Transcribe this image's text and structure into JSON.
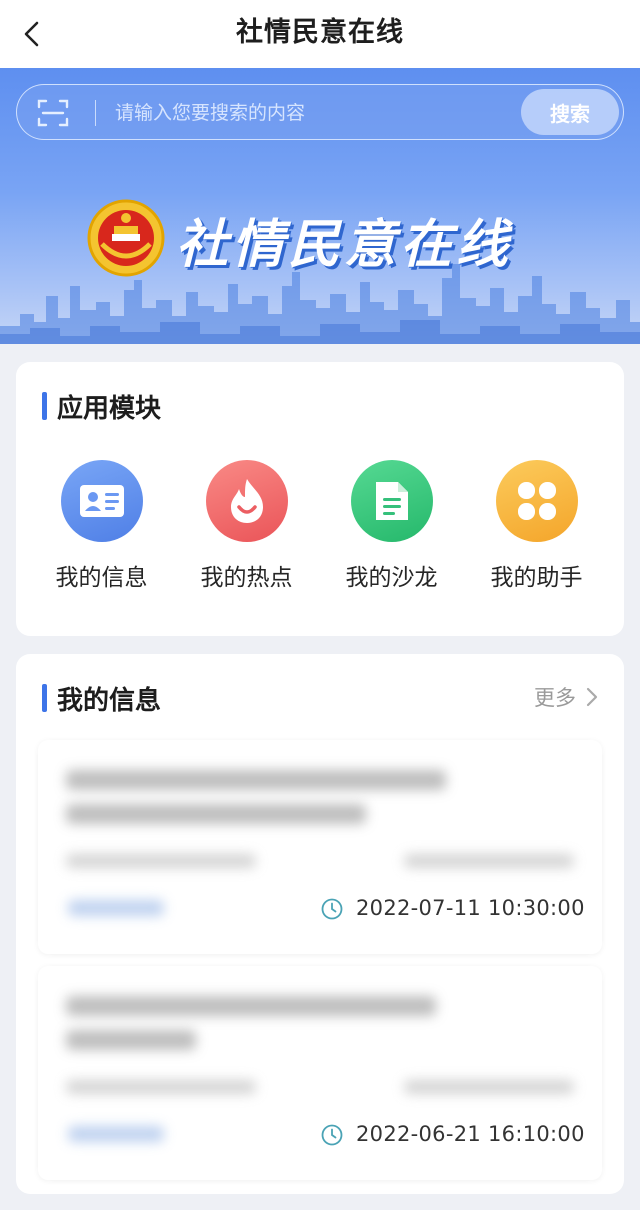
{
  "header": {
    "title": "社情民意在线",
    "back_icon": "chevron-left-icon"
  },
  "search": {
    "placeholder": "请输入您要搜索的内容",
    "button_label": "搜索",
    "scan_icon": "scan-icon"
  },
  "hero": {
    "title": "社情民意在线",
    "emblem_icon": "emblem-icon"
  },
  "modules": {
    "title": "应用模块",
    "items": [
      {
        "label": "我的信息",
        "icon": "id-card-icon",
        "color": "#5b8def"
      },
      {
        "label": "我的热点",
        "icon": "flame-icon",
        "color": "#f06a6e"
      },
      {
        "label": "我的沙龙",
        "icon": "document-icon",
        "color": "#3ac77f"
      },
      {
        "label": "我的助手",
        "icon": "grid-four-icon",
        "color": "#f8b640"
      }
    ]
  },
  "info": {
    "title": "我的信息",
    "more_label": "更多",
    "items": [
      {
        "date": "2022-07-11 10:30:00"
      },
      {
        "date": "2022-06-21 16:10:00"
      }
    ]
  },
  "colors": {
    "accent": "#3d74e8",
    "hero_top": "#5e8ff0",
    "page_bg": "#eef0f5"
  }
}
